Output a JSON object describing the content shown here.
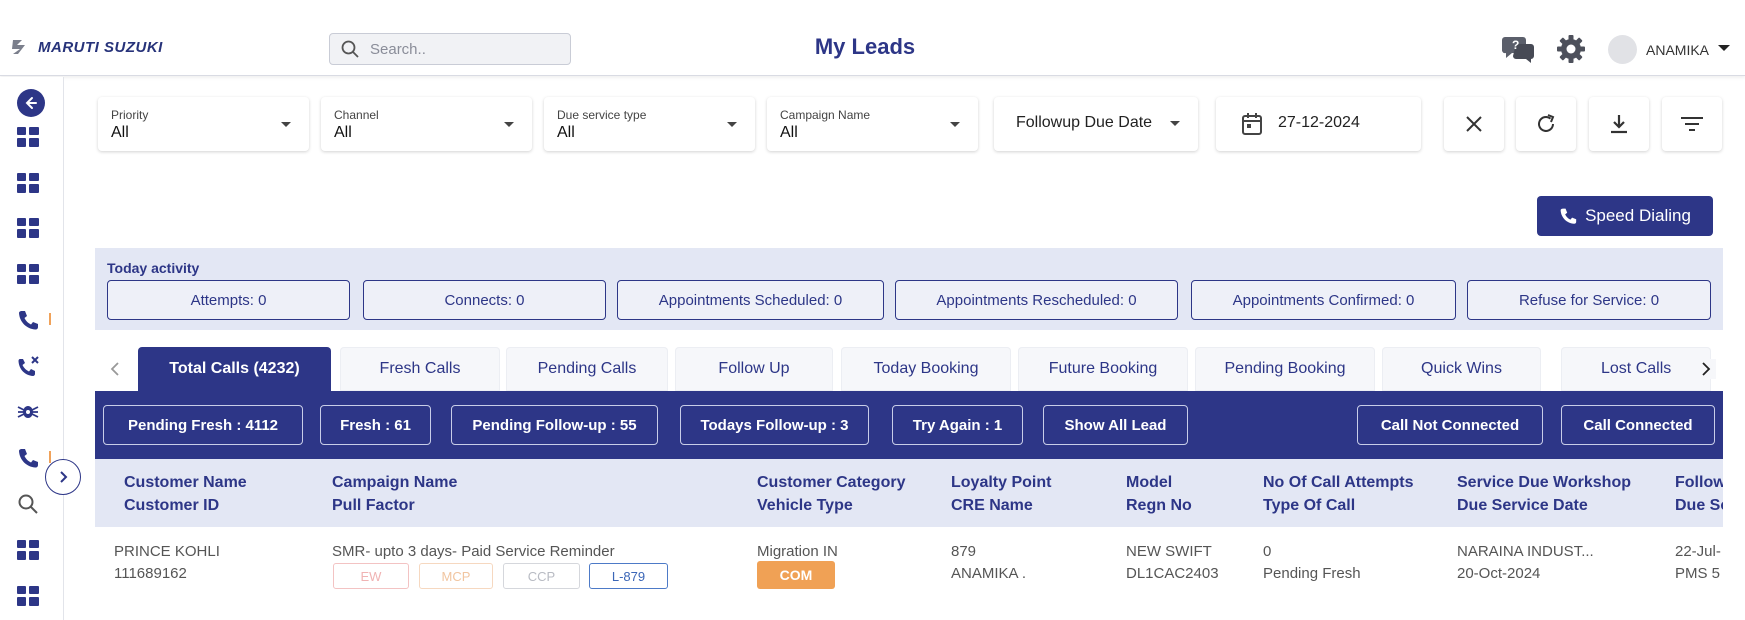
{
  "header": {
    "brand": "MARUTI SUZUKI",
    "search_placeholder": "Search..",
    "title": "My Leads",
    "user": "ANAMIKA",
    "icons": [
      "help-chat-icon",
      "settings-icon"
    ]
  },
  "sidebar": {
    "items": [
      "back-icon",
      "dashboard-icon",
      "dashboard-icon",
      "dashboard-icon",
      "dashboard-icon",
      "phone-icon",
      "missed-call-icon",
      "bug-icon",
      "phone-icon",
      "search-icon",
      "dashboard-icon",
      "dashboard-icon"
    ]
  },
  "filters": {
    "priority": {
      "label": "Priority",
      "value": "All"
    },
    "channel": {
      "label": "Channel",
      "value": "All"
    },
    "due_service_type": {
      "label": "Due service type",
      "value": "All"
    },
    "campaign_name": {
      "label": "Campaign Name",
      "value": "All"
    },
    "date_type": "Followup Due Date",
    "date": "27-12-2024"
  },
  "speed_dialing": "Speed Dialing",
  "today_activity": {
    "title": "Today activity",
    "items": [
      "Attempts: 0",
      "Connects: 0",
      "Appointments Scheduled: 0",
      "Appointments Rescheduled: 0",
      "Appointments Confirmed: 0",
      "Refuse for Service: 0"
    ]
  },
  "tabs": [
    "Total Calls (4232)",
    "Fresh Calls",
    "Pending Calls",
    "Follow Up",
    "Today Booking",
    "Future Booking",
    "Pending Booking",
    "Quick Wins",
    "Lost Calls"
  ],
  "quick_filters": [
    "Pending Fresh : 4112",
    "Fresh : 61",
    "Pending Follow-up : 55",
    "Todays Follow-up : 3",
    "Try Again : 1",
    "Show All Lead",
    "Call Not Connected",
    "Call Connected"
  ],
  "table": {
    "columns": [
      [
        "Customer Name",
        "Customer ID"
      ],
      [
        "Campaign Name",
        "Pull Factor"
      ],
      [
        "Customer Category",
        "Vehicle Type"
      ],
      [
        "Loyalty Point",
        "CRE Name"
      ],
      [
        "Model",
        "Regn No"
      ],
      [
        "No Of Call Attempts",
        "Type Of Call"
      ],
      [
        "Service Due Workshop",
        "Due Service Date"
      ],
      [
        "Follow",
        "Due Se"
      ]
    ],
    "row": {
      "customer_name": "PRINCE KOHLI",
      "customer_id": "111689162",
      "campaign_name": "SMR- upto 3 days- Paid Service Reminder",
      "tags": [
        "EW",
        "MCP",
        "CCP",
        "L-879"
      ],
      "customer_category": "Migration IN",
      "vehicle_type": "COM",
      "loyalty_point": "879",
      "cre_name": "ANAMIKA .",
      "model": "NEW SWIFT",
      "regn_no": "DL1CAC2403",
      "call_attempts": "0",
      "type_of_call": "Pending Fresh",
      "workshop": "NARAINA INDUST...",
      "due_service_date": "20-Oct-2024",
      "followup_date": "22-Jul-",
      "due_service": "PMS 5"
    }
  },
  "colors": {
    "primary": "#2d3687",
    "accent_orange": "#f0a155",
    "light_panel": "#e3e7f4"
  }
}
